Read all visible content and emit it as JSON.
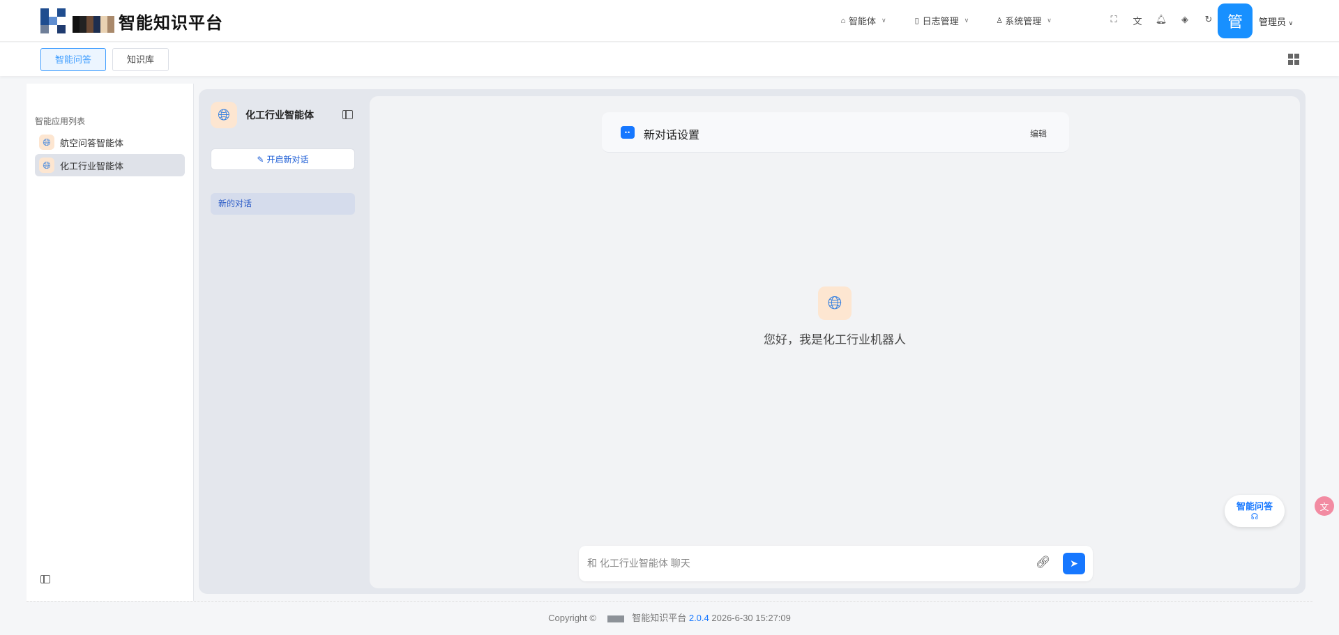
{
  "header": {
    "title": "智能知识平台",
    "nav": [
      {
        "icon": "robot-icon",
        "label": "智能体"
      },
      {
        "icon": "book-icon",
        "label": "日志管理"
      },
      {
        "icon": "user-icon",
        "label": "系统管理"
      }
    ],
    "tools": [
      "fullscreen-icon",
      "translate-icon",
      "bell-icon",
      "theme-icon",
      "refresh-icon"
    ],
    "avatar_text": "管",
    "user_name": "管理员"
  },
  "tabs": [
    "智能问答",
    "知识库"
  ],
  "sidebar": {
    "title": "智能应用列表",
    "items": [
      "航空问答智能体",
      "化工行业智能体"
    ]
  },
  "conversation_panel": {
    "agent_name": "化工行业智能体",
    "new_chat_label": "开启新对话",
    "conversations": [
      "新的对话"
    ]
  },
  "chat": {
    "settings_title": "新对话设置",
    "settings_edit": "编辑",
    "welcome": "您好，我是化工行业机器人",
    "input_placeholder": "和 化工行业智能体 聊天"
  },
  "float_button": {
    "label": "智能问答"
  },
  "footer": {
    "copyright": "Copyright ©",
    "product": "智能知识平台",
    "version": "2.0.4",
    "timestamp": "2026-6-30 15:27:09"
  },
  "colors": {
    "primary": "#1677ff",
    "avatar": "#1890ff",
    "agent_icon_bg": "#fde6d1"
  }
}
